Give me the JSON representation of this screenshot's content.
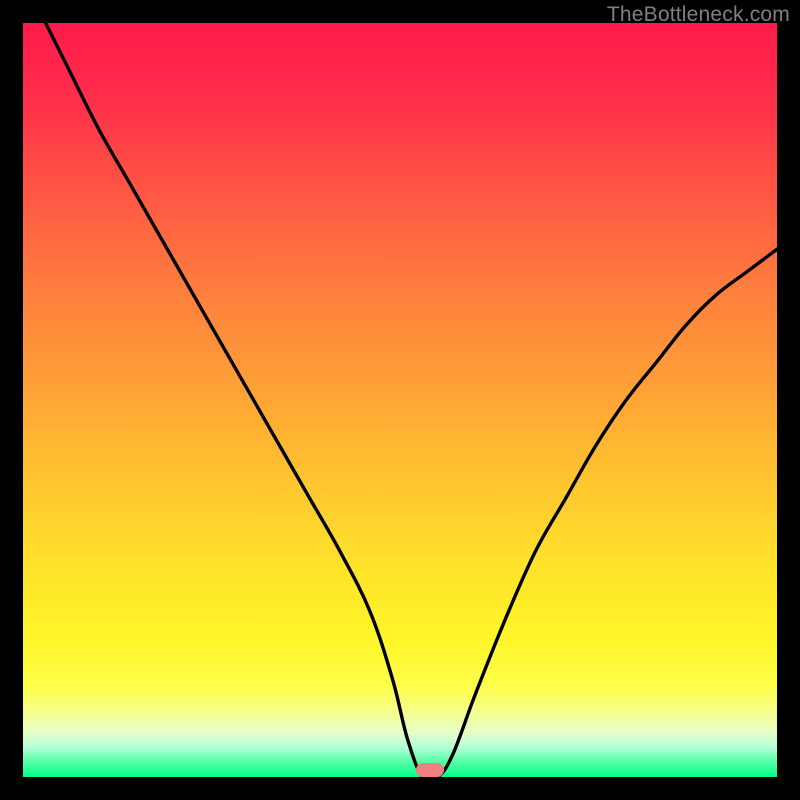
{
  "watermark": "TheBottleneck.com",
  "marker": {
    "x_pct": 54.0,
    "y_pct": 99.1,
    "color": "#f08080"
  },
  "chart_data": {
    "type": "line",
    "title": "",
    "xlabel": "",
    "ylabel": "",
    "xlim": [
      0,
      100
    ],
    "ylim": [
      0,
      100
    ],
    "grid": false,
    "legend": false,
    "annotations": [
      {
        "text": "TheBottleneck.com",
        "position": "top-right"
      }
    ],
    "series": [
      {
        "name": "bottleneck-curve",
        "x": [
          3,
          6,
          10,
          14,
          18,
          22,
          26,
          30,
          34,
          38,
          42,
          46,
          49,
          51,
          53,
          55,
          57,
          60,
          64,
          68,
          72,
          76,
          80,
          84,
          88,
          92,
          96,
          100
        ],
        "y": [
          100,
          94,
          86,
          79,
          72,
          65,
          58,
          51,
          44,
          37,
          30,
          22,
          13,
          5,
          0,
          0,
          3,
          11,
          21,
          30,
          37,
          44,
          50,
          55,
          60,
          64,
          67,
          70
        ]
      }
    ],
    "minimum_marker": {
      "x": 54.0,
      "y": 0.9
    }
  }
}
